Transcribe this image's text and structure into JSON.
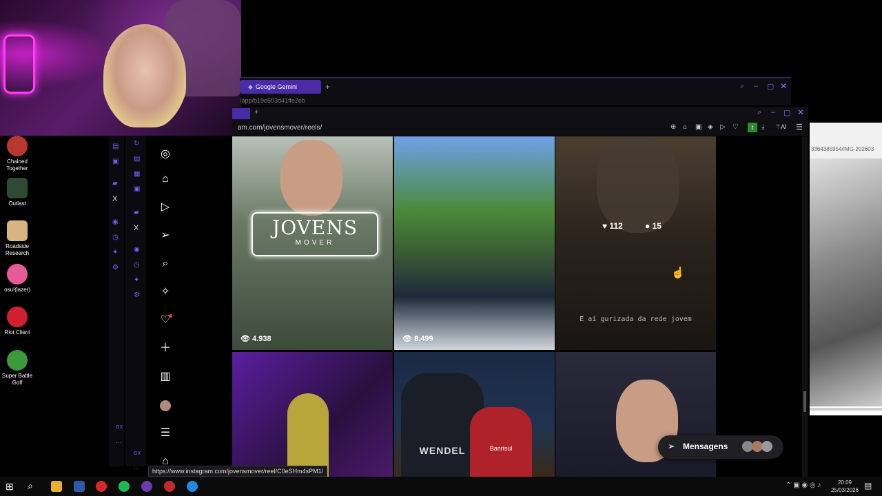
{
  "desktop_icons": [
    {
      "label": "Chained Together",
      "color": "#b9372f"
    },
    {
      "label": "Outlast",
      "color": "#2f4a32"
    },
    {
      "label": "Roadside Research",
      "color": "#d8b483"
    },
    {
      "label": "osu!(lazer)",
      "color": "#e75a9a"
    },
    {
      "label": "Riot Client",
      "color": "#d0202f"
    },
    {
      "label": "Super Battle Golf",
      "color": "#3a9a3c"
    }
  ],
  "back_browser": {
    "tab_label": "Google Gemini",
    "address": "/app/b19e503d41ffe2eb"
  },
  "front_browser": {
    "address": "am.com/jovensmover/reels/",
    "status_url": "https://www.instagram.com/jovensmover/reel/C0eSHm4sPM1/",
    "ai_label": "AI"
  },
  "reels": [
    {
      "views": "4.938",
      "overlay_title": "JOVENS",
      "overlay_sub": "MOVER"
    },
    {
      "views": "8.499"
    },
    {
      "likes": "112",
      "comments": "15",
      "caption": "E aí gurizada da rede jovem"
    },
    {},
    {
      "jersey_text": "WENDEL",
      "shirt_text": "Banrisul"
    },
    {}
  ],
  "messages_button": {
    "label": "Mensagens"
  },
  "right_pane": {
    "address": "3364385954/IMG-202603"
  },
  "side_rail": {
    "label_a": "GX",
    "label_b": "GX"
  },
  "clock": {
    "time": "20:09",
    "date": "25/03/2026"
  }
}
